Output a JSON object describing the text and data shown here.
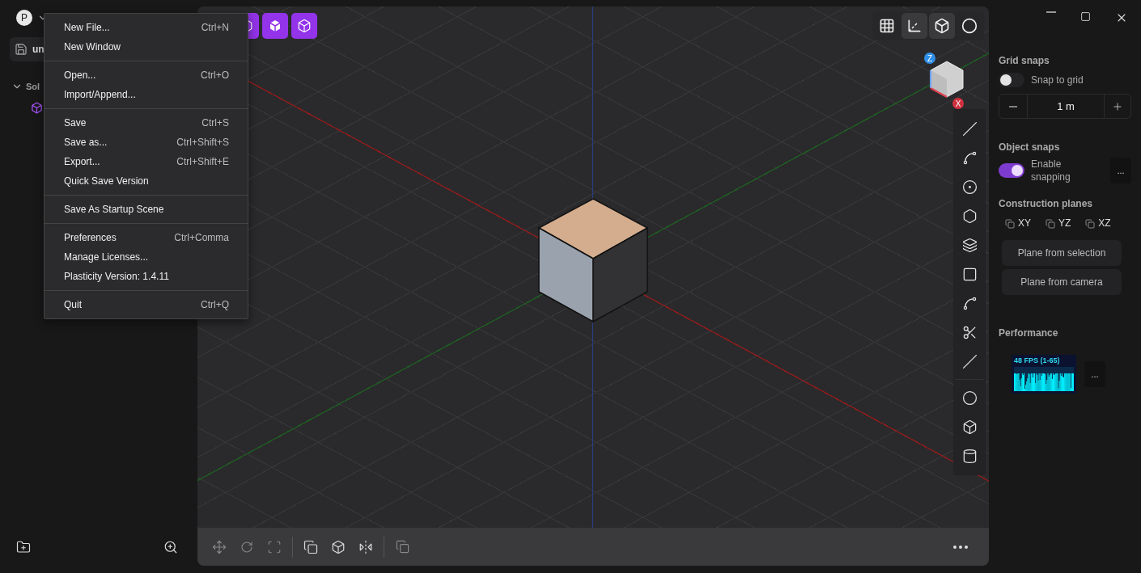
{
  "sidebar": {
    "avatar": "P",
    "file_name": "un",
    "outline": {
      "label": "Sol",
      "expanded": true
    }
  },
  "file_menu": {
    "groups": [
      [
        {
          "label": "New File...",
          "shortcut": "Ctrl+N"
        },
        {
          "label": "New Window"
        }
      ],
      [
        {
          "label": "Open...",
          "shortcut": "Ctrl+O"
        },
        {
          "label": "Import/Append..."
        }
      ],
      [
        {
          "label": "Save",
          "shortcut": "Ctrl+S"
        },
        {
          "label": "Save as...",
          "shortcut": "Ctrl+Shift+S"
        },
        {
          "label": "Export...",
          "shortcut": "Ctrl+Shift+E"
        },
        {
          "label": "Quick Save Version"
        }
      ],
      [
        {
          "label": "Save As Startup Scene"
        }
      ],
      [
        {
          "label": "Preferences",
          "shortcut": "Ctrl+Comma"
        },
        {
          "label": "Manage Licenses..."
        },
        {
          "label": "Plasticity Version: 1.4.11"
        }
      ],
      [
        {
          "label": "Quit",
          "shortcut": "Ctrl+Q"
        }
      ]
    ]
  },
  "viewport": {
    "view_toolbar": [
      {
        "kind": "grid",
        "selected": false
      },
      {
        "kind": "axes",
        "selected": true
      },
      {
        "kind": "xray",
        "selected": true
      },
      {
        "kind": "shading",
        "selected": false
      }
    ],
    "nav_cube": {
      "z_label": "Z",
      "x_label": "X"
    }
  },
  "right_panel": {
    "grid_snaps": {
      "title": "Grid snaps",
      "toggle": {
        "label": "Snap to grid",
        "on": false
      },
      "size": "1 m"
    },
    "object_snaps": {
      "title": "Object snaps",
      "toggle": {
        "label": "Enable snapping",
        "on": true
      },
      "more": "..."
    },
    "construction_planes": {
      "title": "Construction planes",
      "planes": [
        "XY",
        "YZ",
        "XZ"
      ],
      "buttons": [
        "Plane from selection",
        "Plane from camera"
      ]
    },
    "performance": {
      "title": "Performance",
      "fps": "48 FPS (1-65)",
      "more": "..."
    }
  }
}
